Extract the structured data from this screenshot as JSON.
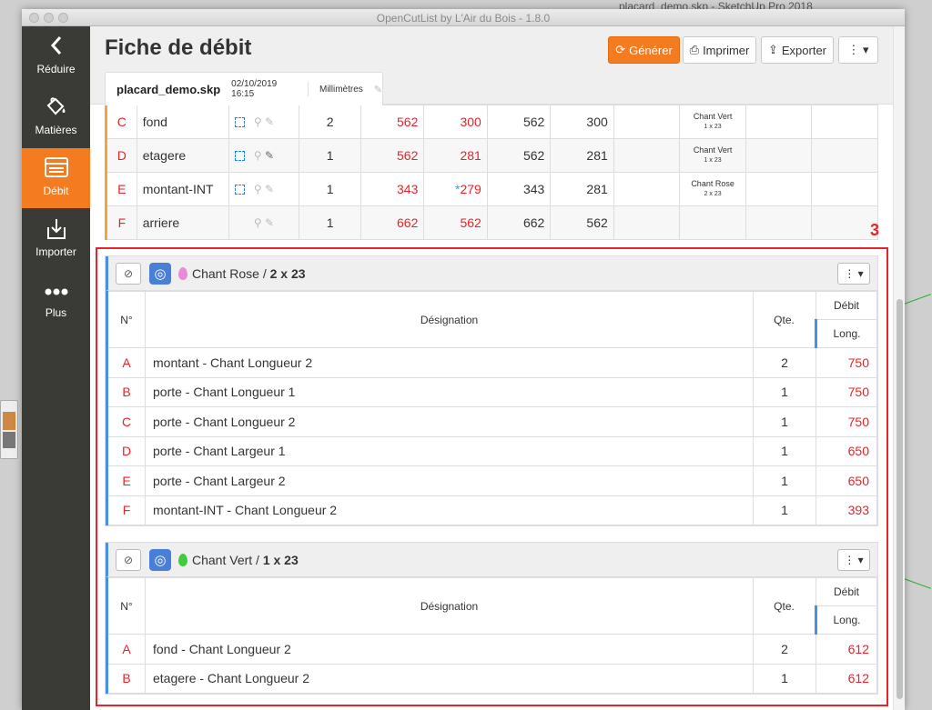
{
  "desktop": {
    "background_window_title": "placard_demo.skp - SketchUp Pro 2018"
  },
  "window": {
    "title": "OpenCutList by L'Air du Bois - 1.8.0"
  },
  "sidebar": {
    "items": [
      {
        "label": "Réduire",
        "icon": "chevron-left-icon"
      },
      {
        "label": "Matières",
        "icon": "paint-bucket-icon"
      },
      {
        "label": "Débit",
        "icon": "list-icon",
        "active": true
      },
      {
        "label": "Importer",
        "icon": "import-icon"
      },
      {
        "label": "Plus",
        "icon": "ellipsis-icon"
      }
    ]
  },
  "header": {
    "title": "Fiche de débit",
    "buttons": {
      "generate": "Générer",
      "print": "Imprimer",
      "export": "Exporter"
    },
    "file": {
      "name": "placard_demo.skp",
      "date": "02/10/2019 16:15",
      "unit": "Millimètres"
    }
  },
  "parts": [
    {
      "id": "C",
      "name": "fond",
      "qty": "2",
      "l1": "562",
      "w1": "300",
      "l2": "562",
      "w2": "300",
      "edge": "Chant Vert",
      "edge_size": "1 x 23",
      "has_sq": true,
      "pen_dark": false
    },
    {
      "id": "D",
      "name": "etagere",
      "qty": "1",
      "l1": "562",
      "w1": "281",
      "l2": "562",
      "w2": "281",
      "edge": "Chant Vert",
      "edge_size": "1 x 23",
      "has_sq": true,
      "pen_dark": true
    },
    {
      "id": "E",
      "name": "montant-INT",
      "qty": "1",
      "l1": "343",
      "w1": "279",
      "w1_star": "*",
      "l2": "343",
      "w2": "281",
      "edge": "Chant Rose",
      "edge_size": "2 x 23",
      "has_sq": true,
      "pen_dark": false
    },
    {
      "id": "F",
      "name": "arriere",
      "qty": "1",
      "l1": "662",
      "w1": "562",
      "l2": "662",
      "w2": "562",
      "edge": "",
      "edge_size": "",
      "has_sq": false,
      "pen_dark": false
    }
  ],
  "annotation": {
    "number": "3"
  },
  "groups": [
    {
      "name": "Chant Rose",
      "size": "2 x 23",
      "drop_color": "#e88ad8",
      "headers": {
        "num": "N°",
        "designation": "Désignation",
        "qty": "Qte.",
        "cut": "Débit",
        "length": "Long."
      },
      "rows": [
        {
          "id": "A",
          "designation": "montant - Chant Longueur 2",
          "qty": "2",
          "length": "750"
        },
        {
          "id": "B",
          "designation": "porte - Chant Longueur 1",
          "qty": "1",
          "length": "750"
        },
        {
          "id": "C",
          "designation": "porte - Chant Longueur 2",
          "qty": "1",
          "length": "750"
        },
        {
          "id": "D",
          "designation": "porte - Chant Largeur 1",
          "qty": "1",
          "length": "650"
        },
        {
          "id": "E",
          "designation": "porte - Chant Largeur 2",
          "qty": "1",
          "length": "650"
        },
        {
          "id": "F",
          "designation": "montant-INT - Chant Longueur 2",
          "qty": "1",
          "length": "393"
        }
      ]
    },
    {
      "name": "Chant Vert",
      "size": "1 x 23",
      "drop_color": "#3ecb3e",
      "headers": {
        "num": "N°",
        "designation": "Désignation",
        "qty": "Qte.",
        "cut": "Débit",
        "length": "Long."
      },
      "rows": [
        {
          "id": "A",
          "designation": "fond - Chant Longueur 2",
          "qty": "2",
          "length": "612"
        },
        {
          "id": "B",
          "designation": "etagere - Chant Longueur 2",
          "qty": "1",
          "length": "612"
        }
      ]
    }
  ],
  "colors": {
    "accent": "#f47b20",
    "red": "#e8232a",
    "blue": "#4a90e2"
  }
}
